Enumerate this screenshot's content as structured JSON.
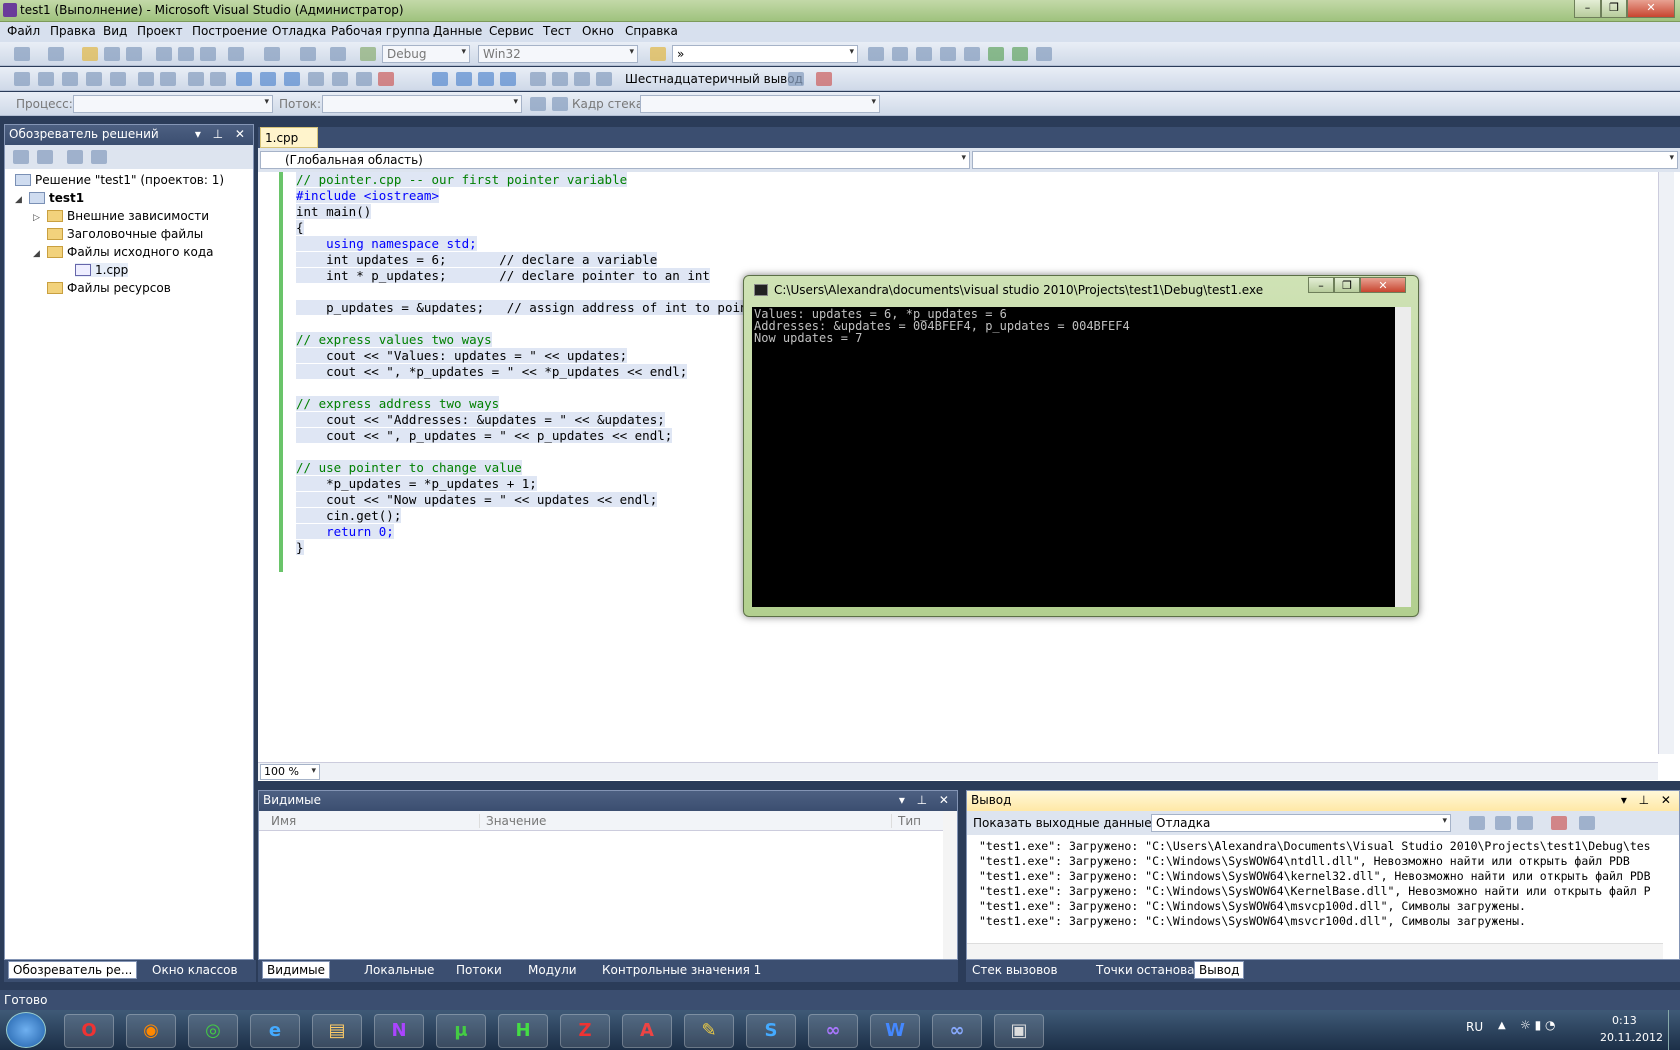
{
  "window": {
    "title": "test1 (Выполнение) - Microsoft Visual Studio (Администратор)"
  },
  "menu": [
    "Файл",
    "Правка",
    "Вид",
    "Проект",
    "Построение",
    "Отладка",
    "Рабочая группа",
    "Данные",
    "Сервис",
    "Тест",
    "Окно",
    "Справка"
  ],
  "toolbar": {
    "config": "Debug",
    "platform": "Win32",
    "find": "»",
    "hex_display": "Шестнадцатеричный вывод",
    "process_label": "Процесс:",
    "thread_label": "Поток:",
    "stack_label": "Кадр стека:"
  },
  "solution_explorer": {
    "title": "Обозреватель решений",
    "solution": "Решение \"test1\" (проектов: 1)",
    "project": "test1",
    "items": [
      "Внешние зависимости",
      "Заголовочные файлы",
      "Файлы исходного кода",
      "1.cpp",
      "Файлы ресурсов"
    ],
    "tabs": [
      "Обозреватель ре...",
      "Окно классов"
    ]
  },
  "editor": {
    "tab": "1.cpp",
    "scope": "(Глобальная область)",
    "zoom": "100 %"
  },
  "code": [
    "// pointer.cpp -- our first pointer variable",
    "#include <iostream>",
    "int main()",
    "{",
    "    using namespace std;",
    "    int updates = 6;       // declare a variable",
    "    int * p_updates;       // declare pointer to an int",
    "",
    "    p_updates = &updates;   // assign address of int to pointer",
    "",
    "// express values two ways",
    "    cout << \"Values: updates = \" << updates;",
    "    cout << \", *p_updates = \" << *p_updates << endl;",
    "",
    "// express address two ways",
    "    cout << \"Addresses: &updates = \" << &updates;",
    "    cout << \", p_updates = \" << p_updates << endl;",
    "",
    "// use pointer to change value",
    "    *p_updates = *p_updates + 1;",
    "    cout << \"Now updates = \" << updates << endl;",
    "    cin.get();",
    "    return 0;",
    "}"
  ],
  "console": {
    "title": "C:\\Users\\Alexandra\\documents\\visual studio 2010\\Projects\\test1\\Debug\\test1.exe",
    "lines": [
      "Values: updates = 6, *p_updates = 6",
      "Addresses: &updates = 004BFEF4, p_updates = 004BFEF4",
      "Now updates = 7"
    ]
  },
  "watch": {
    "title": "Видимые",
    "cols": [
      "Имя",
      "Значение",
      "Тип"
    ],
    "tabs": [
      "Видимые",
      "Локальные",
      "Потоки",
      "Модули",
      "Контрольные значения 1"
    ]
  },
  "output": {
    "title": "Вывод",
    "show_from_label": "Показать выходные данные от:",
    "source": "Отладка",
    "lines": [
      "\"test1.exe\": Загружено: \"C:\\Users\\Alexandra\\Documents\\Visual Studio 2010\\Projects\\test1\\Debug\\tes",
      "\"test1.exe\": Загружено: \"C:\\Windows\\SysWOW64\\ntdll.dll\", Невозможно найти или открыть файл PDB",
      "\"test1.exe\": Загружено: \"C:\\Windows\\SysWOW64\\kernel32.dll\", Невозможно найти или открыть файл PDB",
      "\"test1.exe\": Загружено: \"C:\\Windows\\SysWOW64\\KernelBase.dll\", Невозможно найти или открыть файл P",
      "\"test1.exe\": Загружено: \"C:\\Windows\\SysWOW64\\msvcp100d.dll\", Символы загружены.",
      "\"test1.exe\": Загружено: \"C:\\Windows\\SysWOW64\\msvcr100d.dll\", Символы загружены."
    ],
    "tabs": [
      "Стек вызовов",
      "Точки останова",
      "Вывод"
    ]
  },
  "status": "Готово",
  "taskbar": {
    "lang": "RU",
    "time": "0:13",
    "date": "20.11.2012"
  }
}
